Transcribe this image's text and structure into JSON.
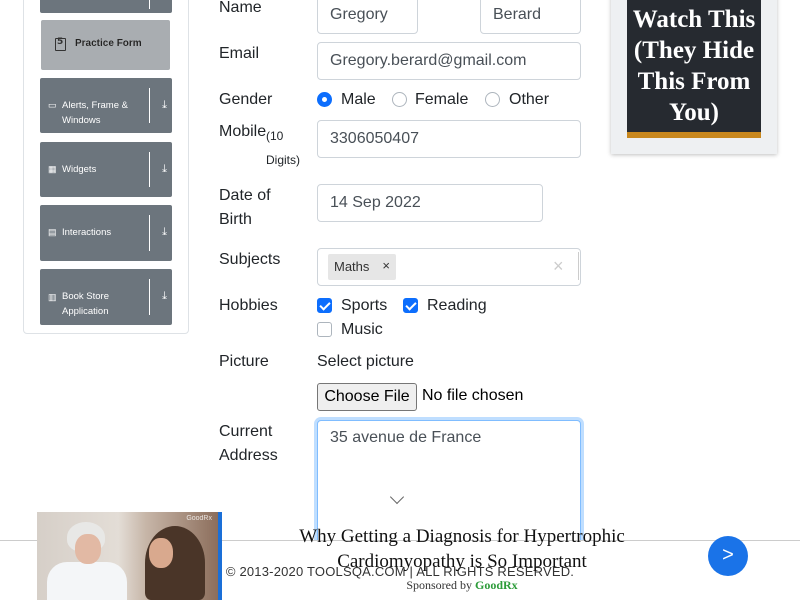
{
  "sidebar": {
    "practice_form": "Practice Form",
    "groups": [
      {
        "label": "Alerts, Frame & Windows",
        "icon": "window-icon"
      },
      {
        "label": "Widgets",
        "icon": "widgets-icon"
      },
      {
        "label": "Interactions",
        "icon": "interactions-icon"
      },
      {
        "label": "Book Store Application",
        "icon": "book-icon"
      }
    ]
  },
  "form": {
    "name_label": "Name",
    "first_name": "Gregory",
    "last_name": "Berard",
    "email_label": "Email",
    "email": "Gregory.berard@gmail.com",
    "gender_label": "Gender",
    "gender_options": [
      "Male",
      "Female",
      "Other"
    ],
    "gender_selected": "Male",
    "mobile_label": "Mobile",
    "mobile_hint": "(10 Digits)",
    "mobile": "3306050407",
    "dob_label_1": "Date of",
    "dob_label_2": "Birth",
    "dob": "14 Sep 2022",
    "subjects_label": "Subjects",
    "subject_tag": "Maths",
    "hobbies_label": "Hobbies",
    "hobbies": [
      {
        "label": "Sports",
        "checked": true
      },
      {
        "label": "Reading",
        "checked": true
      },
      {
        "label": "Music",
        "checked": false
      }
    ],
    "picture_label": "Picture",
    "select_picture": "Select picture",
    "choose_file": "Choose File",
    "no_file": "No file chosen",
    "address_label_1": "Current",
    "address_label_2": "Address",
    "address": "35 avenue de France"
  },
  "side_ad": {
    "title": "Watch This (They Hide This From You)"
  },
  "bottom_ad": {
    "headline": "Why Getting a Diagnosis for Hypertrophic Cardiomyopathy is So Important",
    "sponsor_prefix": "Sponsored by",
    "sponsor": "GoodRx",
    "photo_brand": "GoodRx",
    "next": ">"
  },
  "footer": {
    "copyright": "© 2013-2020 TOOLSQA.COM | ALL RIGHTS RESERVED."
  },
  "colors": {
    "accent": "#0d6efd",
    "sidebar_group": "#6c757d",
    "sidebar_active": "#a9adb1",
    "ad_button": "#1a73e8",
    "sponsor": "#2d9c3a"
  }
}
